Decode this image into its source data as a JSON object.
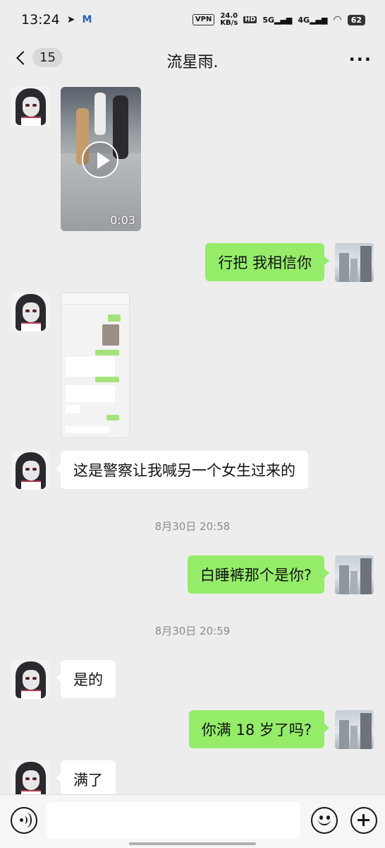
{
  "status_bar": {
    "time": "13:24",
    "vpn": "VPN",
    "speed_value": "24.0",
    "speed_unit": "KB/s",
    "network_5g": "5G",
    "network_4g": "4G",
    "battery": "62"
  },
  "header": {
    "unread_count": "15",
    "title": "流星雨.",
    "more": "···"
  },
  "messages": [
    {
      "sender": "other",
      "type": "video",
      "duration": "0:03"
    },
    {
      "sender": "self",
      "type": "text",
      "text": "行把 我相信你"
    },
    {
      "sender": "other",
      "type": "image"
    },
    {
      "sender": "other",
      "type": "text",
      "text": "这是警察让我喊另一个女生过来的"
    },
    {
      "sender": "system",
      "type": "timestamp",
      "text": "8月30日 20:58"
    },
    {
      "sender": "self",
      "type": "text",
      "text": "白睡裤那个是你?"
    },
    {
      "sender": "system",
      "type": "timestamp",
      "text": "8月30日 20:59"
    },
    {
      "sender": "other",
      "type": "text",
      "text": "是的"
    },
    {
      "sender": "self",
      "type": "text",
      "text": "你满 18 岁了吗?"
    },
    {
      "sender": "other",
      "type": "text",
      "text": "满了"
    }
  ],
  "input_bar": {
    "placeholder": "",
    "icons": [
      "voice-icon",
      "emoji-icon",
      "plus-icon"
    ]
  },
  "colors": {
    "background": "#ededed",
    "self_bubble": "#95ec69",
    "other_bubble": "#ffffff"
  }
}
